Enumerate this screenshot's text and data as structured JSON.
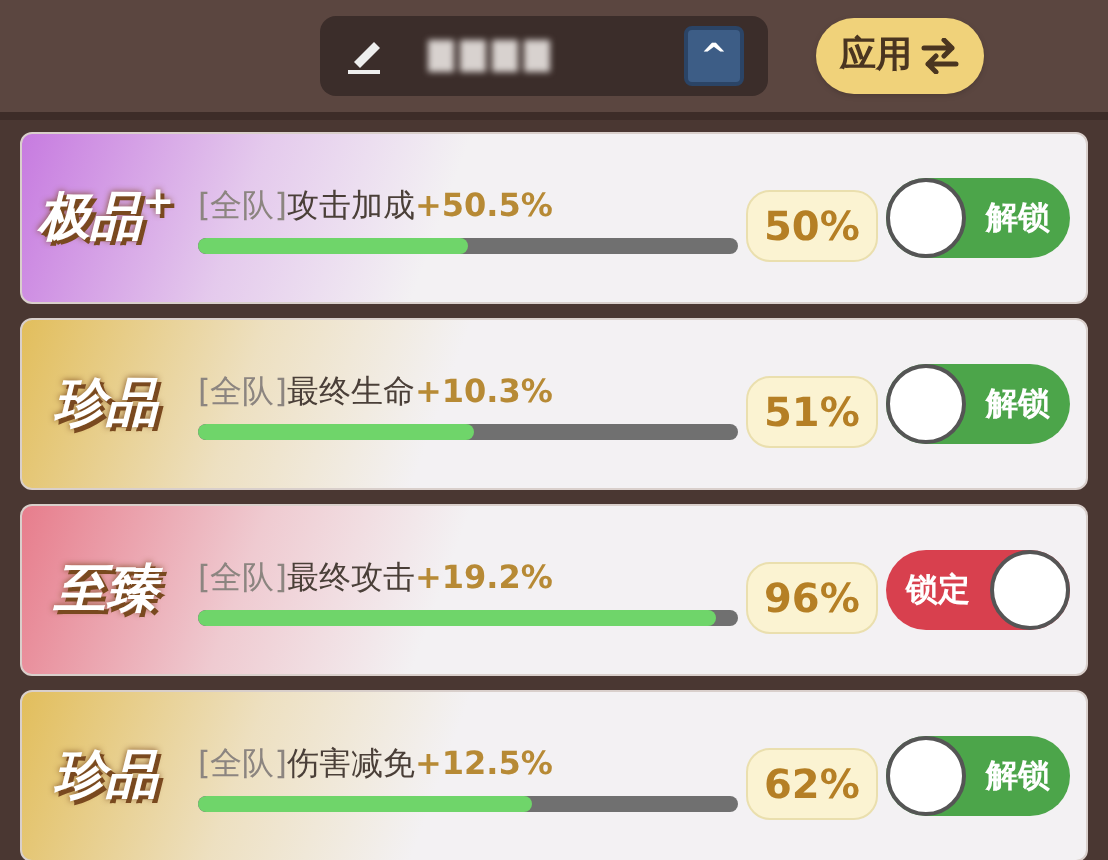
{
  "header": {
    "name_field": {
      "kind": "redacted"
    },
    "collapse_button": "^",
    "apply_button": "应用"
  },
  "buffs": [
    {
      "badge": "极品$^{+}$",
      "color": "#c77be0",
      "scope": "[全队]",
      "stat": "攻击加成",
      "bonus": "+50.5%",
      "level": 0.5,
      "percent": "50%",
      "locked": false,
      "toggle_label": "解锁"
    },
    {
      "badge": "珍品",
      "color": "#e2be5c",
      "scope": "[全队]",
      "stat": "最终生命",
      "bonus": "+10.3%",
      "level": 0.51,
      "percent": "51%",
      "locked": false,
      "toggle_label": "解锁"
    },
    {
      "badge": "至臻",
      "color": "#e77d8c",
      "scope": "[全队]",
      "stat": "最终攻击",
      "bonus": "+19.2%",
      "level": 0.96,
      "percent": "96%",
      "locked": true,
      "toggle_label": "锁定"
    },
    {
      "badge": "珍品",
      "color": "#e2be5c",
      "scope": "[全队]",
      "stat": "伤害减免",
      "bonus": "+12.5%",
      "level": 0.62,
      "percent": "62%",
      "locked": false,
      "toggle_label": "解锁"
    }
  ]
}
